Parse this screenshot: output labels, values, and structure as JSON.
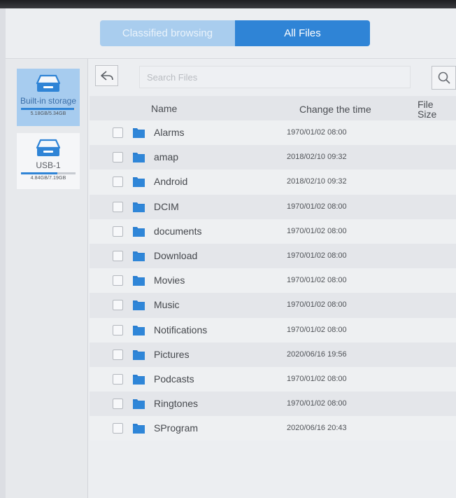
{
  "tabs": [
    {
      "label": "Classified browsing",
      "active": false
    },
    {
      "label": "All Files",
      "active": true
    }
  ],
  "sidebar": {
    "items": [
      {
        "label": "Built-in storage",
        "size": "5.18GB/5.34GB",
        "used_fraction": 0.97,
        "icon": "drive-icon",
        "selected": true
      },
      {
        "label": "USB-1",
        "size": "4.84GB/7.19GB",
        "used_fraction": 0.67,
        "icon": "usb-drive-icon",
        "selected": false
      }
    ]
  },
  "toolbar": {
    "search_placeholder": "Search Files"
  },
  "table": {
    "columns": [
      "Name",
      "Change the time",
      "File Size"
    ],
    "rows": [
      {
        "name": "Alarms",
        "time": "1970/01/02 08:00"
      },
      {
        "name": "amap",
        "time": "2018/02/10 09:32"
      },
      {
        "name": "Android",
        "time": "2018/02/10 09:32"
      },
      {
        "name": "DCIM",
        "time": "1970/01/02 08:00"
      },
      {
        "name": "documents",
        "time": "1970/01/02 08:00"
      },
      {
        "name": "Download",
        "time": "1970/01/02 08:00"
      },
      {
        "name": "Movies",
        "time": "1970/01/02 08:00"
      },
      {
        "name": "Music",
        "time": "1970/01/02 08:00"
      },
      {
        "name": "Notifications",
        "time": "1970/01/02 08:00"
      },
      {
        "name": "Pictures",
        "time": "2020/06/16 19:56"
      },
      {
        "name": "Podcasts",
        "time": "1970/01/02 08:00"
      },
      {
        "name": "Ringtones",
        "time": "1970/01/02 08:00"
      },
      {
        "name": "SProgram",
        "time": "2020/06/16 20:43"
      }
    ]
  },
  "colors": {
    "accent": "#2f84d6",
    "tab_inactive": "#a9cdee",
    "folder": "#2b7fd1"
  }
}
